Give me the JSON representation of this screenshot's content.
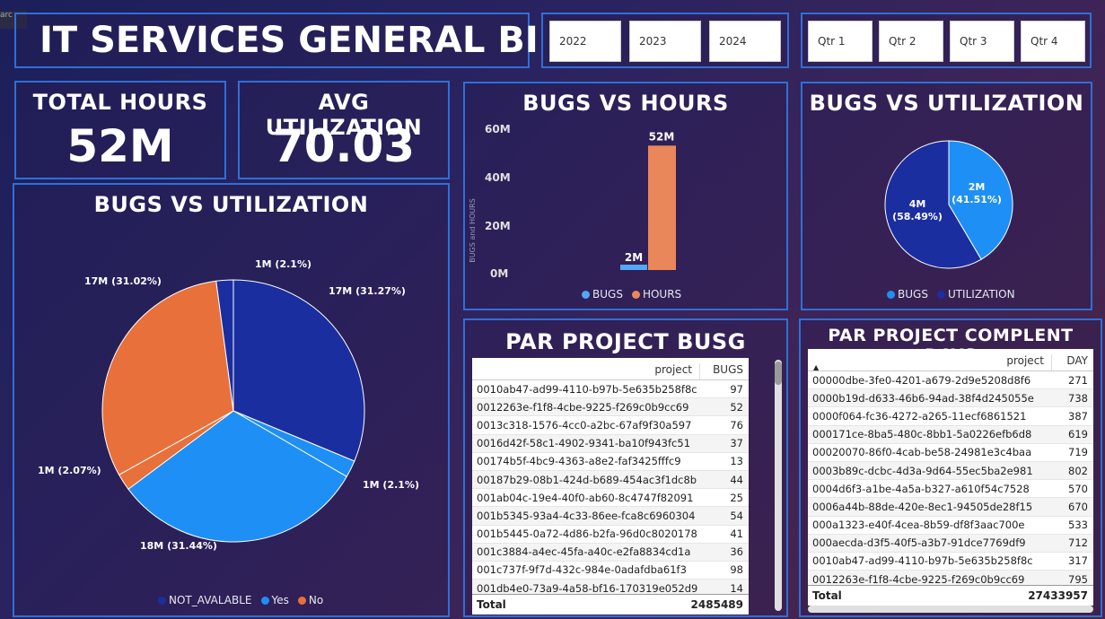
{
  "header": {
    "title": "IT SERVICES GENERAL BI",
    "corner_text": "arc"
  },
  "years": [
    "2022",
    "2023",
    "2024"
  ],
  "quarters": [
    "Qtr 1",
    "Qtr 2",
    "Qtr 3",
    "Qtr 4"
  ],
  "kpis": [
    {
      "label": "TOTAL HOURS",
      "value": "52M"
    },
    {
      "label": "AVG UTILIZATION",
      "value": "70.03"
    }
  ],
  "colors": {
    "dark_blue": "#1a2ea0",
    "light_blue": "#1e8ff5",
    "orange": "#e8703a",
    "bar_orange": "#e9875a",
    "panel_border": "#2f6fd8"
  },
  "pie_main": {
    "title": "BUGS VS UTILIZATION",
    "labels": [
      "17M (31.27%)",
      "1M (2.1%)",
      "18M (31.44%)",
      "1M (2.07%)",
      "17M (31.02%)",
      "1M (2.1%)"
    ],
    "legend": [
      "NOT_AVALABLE",
      "Yes",
      "No"
    ]
  },
  "chart_data": [
    {
      "type": "bar",
      "title": "BUGS VS HOURS",
      "ylabel": "BUGS and HOURS",
      "series": [
        {
          "name": "BUGS",
          "values": [
            2
          ]
        },
        {
          "name": "HOURS",
          "values": [
            52
          ]
        }
      ],
      "data_labels": [
        "2M",
        "52M"
      ],
      "yticks": [
        "0M",
        "20M",
        "40M",
        "60M"
      ],
      "ylim": [
        0,
        60
      ],
      "legend": [
        "BUGS",
        "HOURS"
      ]
    },
    {
      "type": "pie",
      "title": "BUGS VS UTILIZATION",
      "slices": [
        {
          "name": "BUGS",
          "value": 41.51,
          "label": "2M\n(41.51%)"
        },
        {
          "name": "UTILIZATION",
          "value": 58.49,
          "label": "4M\n(58.49%)"
        }
      ],
      "label_lines": {
        "bugs": [
          "2M",
          "(41.51%)"
        ],
        "util": [
          "4M",
          "(58.49%)"
        ]
      },
      "legend": [
        "BUGS",
        "UTILIZATION"
      ]
    },
    {
      "type": "pie",
      "title": "BUGS VS UTILIZATION",
      "slices": [
        {
          "name": "NOT_AVALABLE",
          "value": 31.27
        },
        {
          "name": "Yes",
          "value": 2.1
        },
        {
          "name": "Yes",
          "value": 31.44
        },
        {
          "name": "No",
          "value": 2.07
        },
        {
          "name": "No",
          "value": 31.02
        },
        {
          "name": "NOT_AVALABLE",
          "value": 2.1
        }
      ]
    }
  ],
  "table_bugs": {
    "title": "PAR PROJECT BUSG",
    "columns": [
      "project",
      "BUGS"
    ],
    "rows": [
      [
        "0010ab47-ad99-4110-b97b-5e635b258f8c",
        "97"
      ],
      [
        "0012263e-f1f8-4cbe-9225-f269c0b9cc69",
        "52"
      ],
      [
        "0013c318-1576-4cc0-a2bc-67af9f30a597",
        "76"
      ],
      [
        "0016d42f-58c1-4902-9341-ba10f943fc51",
        "37"
      ],
      [
        "00174b5f-4bc9-4363-a8e2-faf3425fffc9",
        "13"
      ],
      [
        "00187b29-08b1-424d-b689-454ac3f1dc8b",
        "44"
      ],
      [
        "001ab04c-19e4-40f0-ab60-8c4747f82091",
        "25"
      ],
      [
        "001b5345-93a4-4c33-86ee-fca8c6960304",
        "54"
      ],
      [
        "001b5445-0a72-4d86-b2fa-96d0c8020178",
        "41"
      ],
      [
        "001c3884-a4ec-45fa-a40c-e2fa8834cd1a",
        "36"
      ],
      [
        "001c737f-9f7d-432c-984e-0adafdba61f3",
        "98"
      ],
      [
        "001db4e0-73a9-4a58-bf16-170319e052d9",
        "14"
      ]
    ],
    "total_label": "Total",
    "total": "2485489"
  },
  "table_days": {
    "title": "PAR PROJECT COMPLENT DAYS",
    "columns": [
      "project",
      "DAY"
    ],
    "rows": [
      [
        "00000dbe-3fe0-4201-a679-2d9e5208d8f6",
        "271"
      ],
      [
        "0000b19d-d633-46b6-94ad-38f4d245055e",
        "738"
      ],
      [
        "0000f064-fc36-4272-a265-11ecf6861521",
        "387"
      ],
      [
        "000171ce-8ba5-480c-8bb1-5a0226efb6d8",
        "619"
      ],
      [
        "00020070-86f0-4cab-be58-24981e3c4baa",
        "719"
      ],
      [
        "0003b89c-dcbc-4d3a-9d64-55ec5ba2e981",
        "802"
      ],
      [
        "0004d6f3-a1be-4a5a-b327-a610f54c7528",
        "570"
      ],
      [
        "0006a44b-88de-420e-8ec1-94505de28f15",
        "670"
      ],
      [
        "000a1323-e40f-4cea-8b59-df8f3aac700e",
        "533"
      ],
      [
        "000aecda-d3f5-40f5-a3b7-91dce7769df9",
        "712"
      ],
      [
        "0010ab47-ad99-4110-b97b-5e635b258f8c",
        "317"
      ],
      [
        "0012263e-f1f8-4cbe-9225-f269c0b9cc69",
        "795"
      ]
    ],
    "total_label": "Total",
    "total": "27433957"
  }
}
